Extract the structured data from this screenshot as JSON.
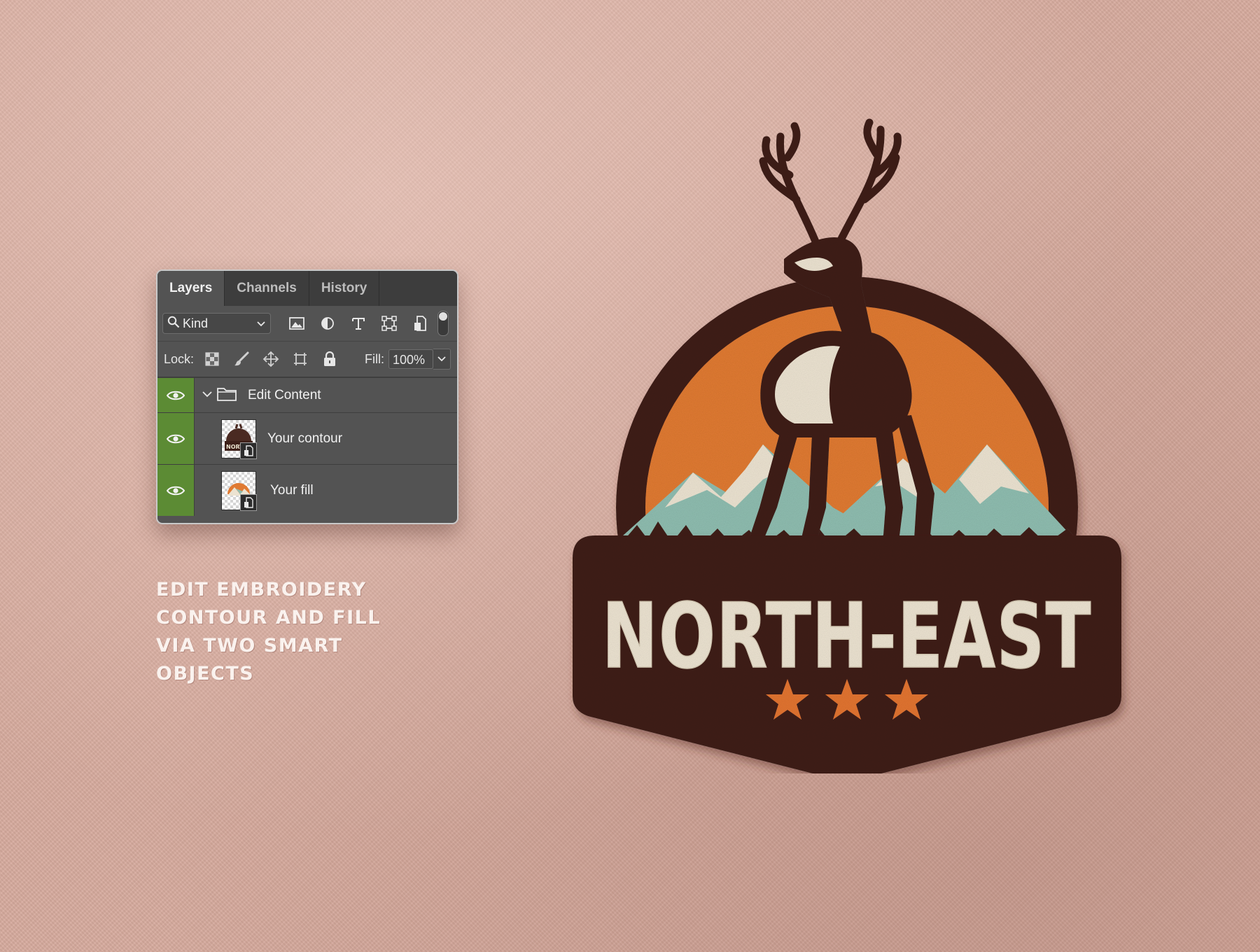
{
  "panel": {
    "tabs": [
      "Layers",
      "Channels",
      "History"
    ],
    "active_tab": "Layers",
    "filter": {
      "kind_label": "Kind",
      "kind_icon": "search-icon",
      "icons": [
        "image-filter-icon",
        "adjustment-filter-icon",
        "type-filter-icon",
        "shape-filter-icon",
        "smart-object-filter-icon"
      ]
    },
    "lock": {
      "label": "Lock:",
      "icons": [
        "lock-transparent-pixels-icon",
        "lock-image-pixels-icon",
        "lock-position-icon",
        "lock-artboard-icon",
        "lock-all-icon"
      ],
      "fill_label": "Fill:",
      "fill_value": "100%"
    },
    "layers": [
      {
        "name": "Edit Content",
        "type": "group",
        "visible": true
      },
      {
        "name": "Your contour",
        "type": "smart-object",
        "visible": true
      },
      {
        "name": "Your fill",
        "type": "smart-object",
        "visible": true
      }
    ]
  },
  "caption": {
    "lines": [
      "EDIT EMBROIDERY",
      "CONTOUR AND FILL",
      "VIA TWO SMART",
      "OBJECTS"
    ]
  },
  "badge": {
    "wordmark": "NORTH-EAST",
    "stars": 3,
    "colors": {
      "frame": "#3f1e17",
      "sun": "#e07a32",
      "cream": "#ece3d1",
      "mint": "#8fbdb0",
      "star": "#e27431"
    }
  },
  "colors": {
    "background": "#d6aa9d",
    "panel": "#535353",
    "panel_tabbar": "#3d3d3d",
    "visibility_column": "#5c8b34",
    "caption_text": "#faf2ee"
  }
}
